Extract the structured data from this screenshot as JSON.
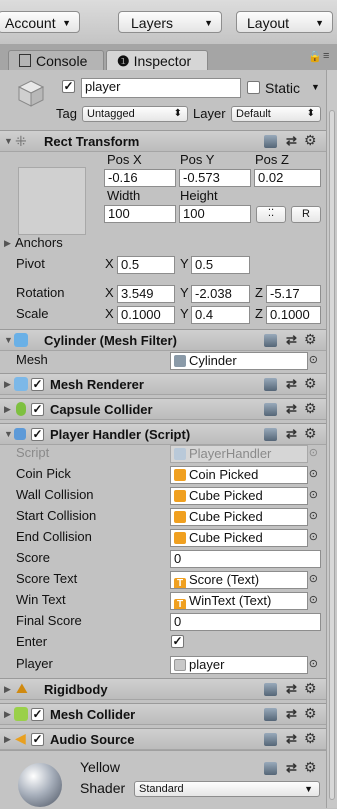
{
  "toolbar": {
    "account": "Account",
    "layers": "Layers",
    "layout": "Layout"
  },
  "tabs": [
    {
      "label": "Console"
    },
    {
      "label": "Inspector"
    }
  ],
  "object": {
    "name": "player",
    "active": true,
    "static_label": "Static",
    "tag_label": "Tag",
    "tag_value": "Untagged",
    "layer_label": "Layer",
    "layer_value": "Default"
  },
  "rect_transform": {
    "title": "Rect Transform",
    "pos_x_label": "Pos X",
    "pos_y_label": "Pos Y",
    "pos_z_label": "Pos Z",
    "pos_x": "-0.16",
    "pos_y": "-0.573",
    "pos_z": "0.02",
    "width_label": "Width",
    "height_label": "Height",
    "width": "100",
    "height": "100",
    "raw_label": "R",
    "anchors_label": "Anchors",
    "pivot_label": "Pivot",
    "pivot_x": "0.5",
    "pivot_y": "0.5",
    "rotation_label": "Rotation",
    "rot_x": "3.549",
    "rot_y": "-2.038",
    "rot_z": "-5.17",
    "scale_label": "Scale",
    "scale_x": "0.1000",
    "scale_y": "0.4",
    "scale_z": "0.1000",
    "x": "X",
    "y": "Y",
    "z": "Z"
  },
  "mesh_filter": {
    "title": "Cylinder (Mesh Filter)",
    "mesh_label": "Mesh",
    "mesh_value": "Cylinder"
  },
  "mesh_renderer": {
    "title": "Mesh Renderer",
    "enabled": true
  },
  "capsule_collider": {
    "title": "Capsule Collider",
    "enabled": true
  },
  "player_handler": {
    "title": "Player Handler (Script)",
    "enabled": true,
    "rows": [
      {
        "label": "Script",
        "value": "PlayerHandler",
        "kind": "script"
      },
      {
        "label": "Coin Pick",
        "value": "Coin Picked",
        "kind": "audio"
      },
      {
        "label": "Wall Collision",
        "value": "Cube Picked",
        "kind": "audio"
      },
      {
        "label": "Start Collision",
        "value": "Cube Picked",
        "kind": "audio"
      },
      {
        "label": "End Collision",
        "value": "Cube Picked",
        "kind": "audio"
      },
      {
        "label": "Score",
        "value": "0",
        "kind": "number"
      },
      {
        "label": "Score Text",
        "value": "Score (Text)",
        "kind": "text"
      },
      {
        "label": "Win Text",
        "value": "WinText (Text)",
        "kind": "text"
      },
      {
        "label": "Final Score",
        "value": "0",
        "kind": "number"
      },
      {
        "label": "Enter",
        "value": "",
        "kind": "bool"
      },
      {
        "label": "Player",
        "value": "player",
        "kind": "object"
      }
    ]
  },
  "rigidbody": {
    "title": "Rigidbody"
  },
  "mesh_collider": {
    "title": "Mesh Collider",
    "enabled": true
  },
  "audio_source": {
    "title": "Audio Source",
    "enabled": true
  },
  "material": {
    "name": "Yellow",
    "shader_label": "Shader",
    "shader_value": "Standard"
  },
  "colors": {
    "panel": "#c2c2c2",
    "header": "#c8c8c8",
    "field": "#ffffff",
    "audio_icon": "#f0a020",
    "text_icon": "#f0a020"
  }
}
